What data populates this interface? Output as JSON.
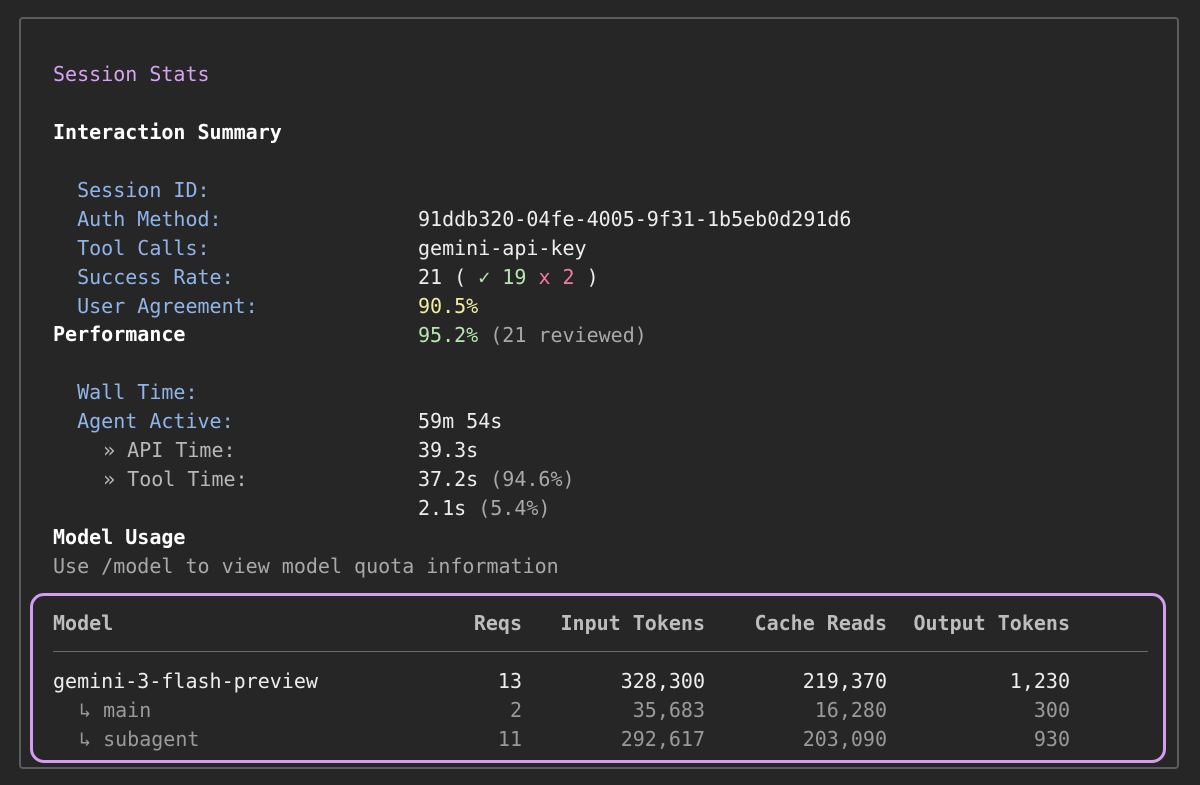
{
  "title": "Session Stats",
  "interaction": {
    "heading": "Interaction Summary",
    "session_id_label": "Session ID:",
    "session_id": "91ddb320-04fe-4005-9f31-1b5eb0d291d6",
    "auth_label": "Auth Method:",
    "auth_value": "gemini-api-key",
    "tool_calls_label": "Tool Calls:",
    "tool_calls_total": "21 (",
    "tool_calls_success": "✓ 19",
    "tool_calls_fail": "x 2",
    "tool_calls_close": ")",
    "success_rate_label": "Success Rate:",
    "success_rate": "90.5%",
    "agreement_label": "User Agreement:",
    "agreement_value": "95.2%",
    "agreement_note": "(21 reviewed)"
  },
  "performance": {
    "heading": "Performance",
    "wall_label": "Wall Time:",
    "wall_value": "59m 54s",
    "active_label": "Agent Active:",
    "active_value": "39.3s",
    "api_label": "» API Time:",
    "api_value": "37.2s",
    "api_pct": "(94.6%)",
    "tool_label": "» Tool Time:",
    "tool_value": "2.1s",
    "tool_pct": "(5.4%)"
  },
  "model_usage": {
    "heading": "Model Usage",
    "hint": "Use /model to view model quota information",
    "columns": [
      "Model",
      "Reqs",
      "Input Tokens",
      "Cache Reads",
      "Output Tokens"
    ],
    "rows": [
      {
        "model": "gemini-3-flash-preview",
        "reqs": "13",
        "input": "328,300",
        "cache": "219,370",
        "output": "1,230"
      },
      {
        "model": "↳ main",
        "reqs": "2",
        "input": "35,683",
        "cache": "16,280",
        "output": "300"
      },
      {
        "model": "↳ subagent",
        "reqs": "11",
        "input": "292,617",
        "cache": "203,090",
        "output": "930"
      }
    ]
  },
  "colors": {
    "title": "#d7a3f0",
    "label": "#8fb4e8",
    "success": "#b6e7b0",
    "fail": "#f07ba0",
    "rate": "#f2eca3",
    "table_border": "#d59cf0"
  }
}
